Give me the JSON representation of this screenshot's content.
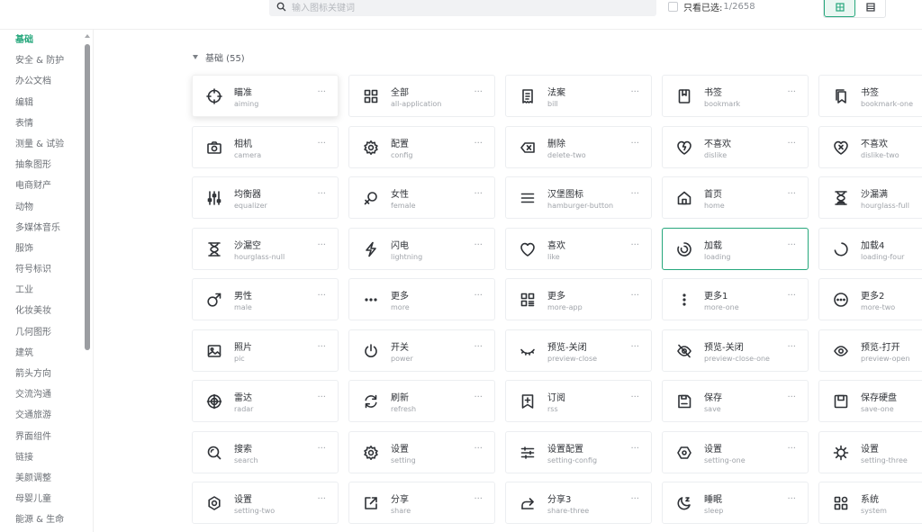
{
  "search": {
    "placeholder": "输入图标关键词"
  },
  "filter": {
    "label": "只看已选:",
    "count": "1/2658"
  },
  "sidebar": {
    "items": [
      "基础",
      "安全 & 防护",
      "办公文档",
      "编辑",
      "表情",
      "测量 & 试验",
      "抽象图形",
      "电商财产",
      "动物",
      "多媒体音乐",
      "服饰",
      "符号标识",
      "工业",
      "化妆美妆",
      "几何图形",
      "建筑",
      "箭头方向",
      "交流沟通",
      "交通旅游",
      "界面组件",
      "链接",
      "美颜调整",
      "母婴儿童",
      "能源 & 生命"
    ],
    "active_index": 0
  },
  "section": {
    "title": "基础 (55)"
  },
  "more_glyph": "···",
  "icons": [
    {
      "zh": "瞄准",
      "en": "aiming",
      "icon": "aiming-icon",
      "state": "hover"
    },
    {
      "zh": "全部",
      "en": "all-application",
      "icon": "all-application-icon"
    },
    {
      "zh": "法案",
      "en": "bill",
      "icon": "bill-icon"
    },
    {
      "zh": "书签",
      "en": "bookmark",
      "icon": "bookmark-icon"
    },
    {
      "zh": "书签",
      "en": "bookmark-one",
      "icon": "bookmark-one-icon"
    },
    {
      "zh": "相机",
      "en": "camera",
      "icon": "camera-icon"
    },
    {
      "zh": "配置",
      "en": "config",
      "icon": "config-icon"
    },
    {
      "zh": "删除",
      "en": "delete-two",
      "icon": "delete-two-icon"
    },
    {
      "zh": "不喜欢",
      "en": "dislike",
      "icon": "dislike-icon"
    },
    {
      "zh": "不喜欢",
      "en": "dislike-two",
      "icon": "dislike-two-icon"
    },
    {
      "zh": "均衡器",
      "en": "equalizer",
      "icon": "equalizer-icon"
    },
    {
      "zh": "女性",
      "en": "female",
      "icon": "female-icon"
    },
    {
      "zh": "汉堡图标",
      "en": "hamburger-button",
      "icon": "hamburger-button-icon"
    },
    {
      "zh": "首页",
      "en": "home",
      "icon": "home-icon"
    },
    {
      "zh": "沙漏满",
      "en": "hourglass-full",
      "icon": "hourglass-full-icon"
    },
    {
      "zh": "沙漏空",
      "en": "hourglass-null",
      "icon": "hourglass-null-icon"
    },
    {
      "zh": "闪电",
      "en": "lightning",
      "icon": "lightning-icon"
    },
    {
      "zh": "喜欢",
      "en": "like",
      "icon": "like-icon"
    },
    {
      "zh": "加载",
      "en": "loading",
      "icon": "loading-icon",
      "state": "selected"
    },
    {
      "zh": "加载4",
      "en": "loading-four",
      "icon": "loading-four-icon"
    },
    {
      "zh": "男性",
      "en": "male",
      "icon": "male-icon"
    },
    {
      "zh": "更多",
      "en": "more",
      "icon": "more-icon"
    },
    {
      "zh": "更多",
      "en": "more-app",
      "icon": "more-app-icon"
    },
    {
      "zh": "更多1",
      "en": "more-one",
      "icon": "more-one-icon"
    },
    {
      "zh": "更多2",
      "en": "more-two",
      "icon": "more-two-icon"
    },
    {
      "zh": "照片",
      "en": "pic",
      "icon": "pic-icon"
    },
    {
      "zh": "开关",
      "en": "power",
      "icon": "power-icon"
    },
    {
      "zh": "预览-关闭",
      "en": "preview-close",
      "icon": "preview-close-icon"
    },
    {
      "zh": "预览-关闭",
      "en": "preview-close-one",
      "icon": "preview-close-one-icon"
    },
    {
      "zh": "预览-打开",
      "en": "preview-open",
      "icon": "preview-open-icon"
    },
    {
      "zh": "雷达",
      "en": "radar",
      "icon": "radar-icon"
    },
    {
      "zh": "刷新",
      "en": "refresh",
      "icon": "refresh-icon"
    },
    {
      "zh": "订阅",
      "en": "rss",
      "icon": "rss-icon"
    },
    {
      "zh": "保存",
      "en": "save",
      "icon": "save-icon"
    },
    {
      "zh": "保存硬盘",
      "en": "save-one",
      "icon": "save-one-icon"
    },
    {
      "zh": "搜索",
      "en": "search",
      "icon": "search-icon"
    },
    {
      "zh": "设置",
      "en": "setting",
      "icon": "setting-icon"
    },
    {
      "zh": "设置配置",
      "en": "setting-config",
      "icon": "setting-config-icon"
    },
    {
      "zh": "设置",
      "en": "setting-one",
      "icon": "setting-one-icon"
    },
    {
      "zh": "设置",
      "en": "setting-three",
      "icon": "setting-three-icon"
    },
    {
      "zh": "设置",
      "en": "setting-two",
      "icon": "setting-two-icon"
    },
    {
      "zh": "分享",
      "en": "share",
      "icon": "share-icon"
    },
    {
      "zh": "分享3",
      "en": "share-three",
      "icon": "share-three-icon"
    },
    {
      "zh": "睡眠",
      "en": "sleep",
      "icon": "sleep-icon"
    },
    {
      "zh": "系统",
      "en": "system",
      "icon": "system-icon"
    }
  ],
  "colors": {
    "accent": "#26a77c",
    "border": "#eceef1",
    "muted": "#a0a4aa"
  }
}
